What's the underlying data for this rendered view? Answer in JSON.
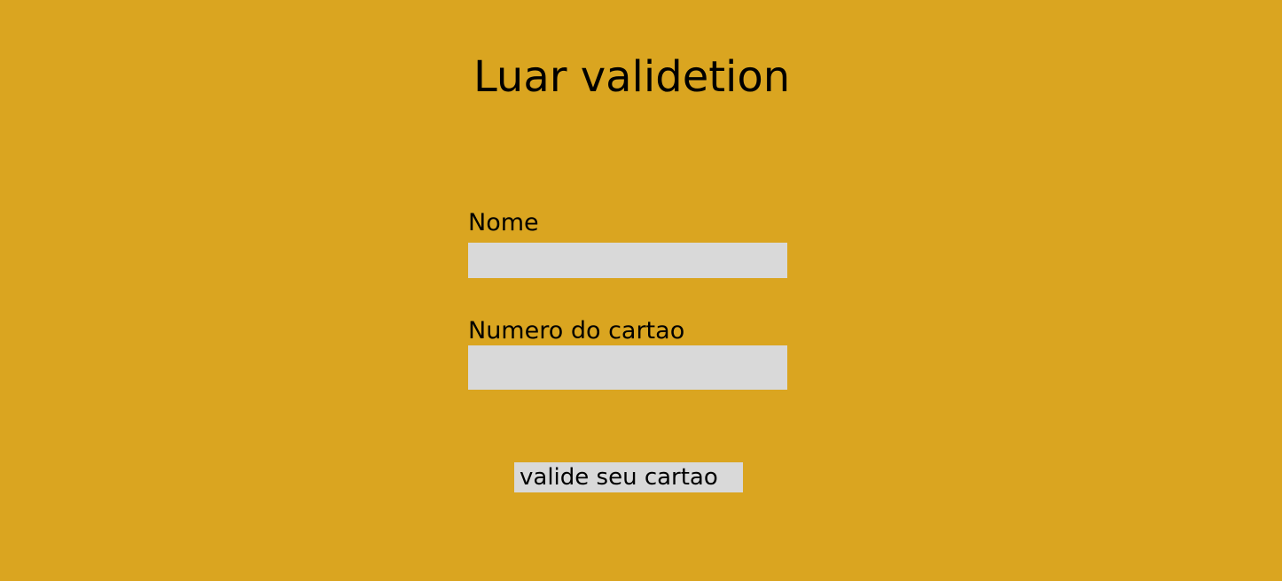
{
  "page": {
    "title": "Luar validetion",
    "background_color": "#DAA520"
  },
  "form": {
    "nome": {
      "label": "Nome",
      "value": "",
      "placeholder": ""
    },
    "numero_cartao": {
      "label": "Numero do cartao",
      "value": "",
      "placeholder": ""
    },
    "submit_label": "valide seu cartao",
    "field_color": "#D9D9D9"
  }
}
